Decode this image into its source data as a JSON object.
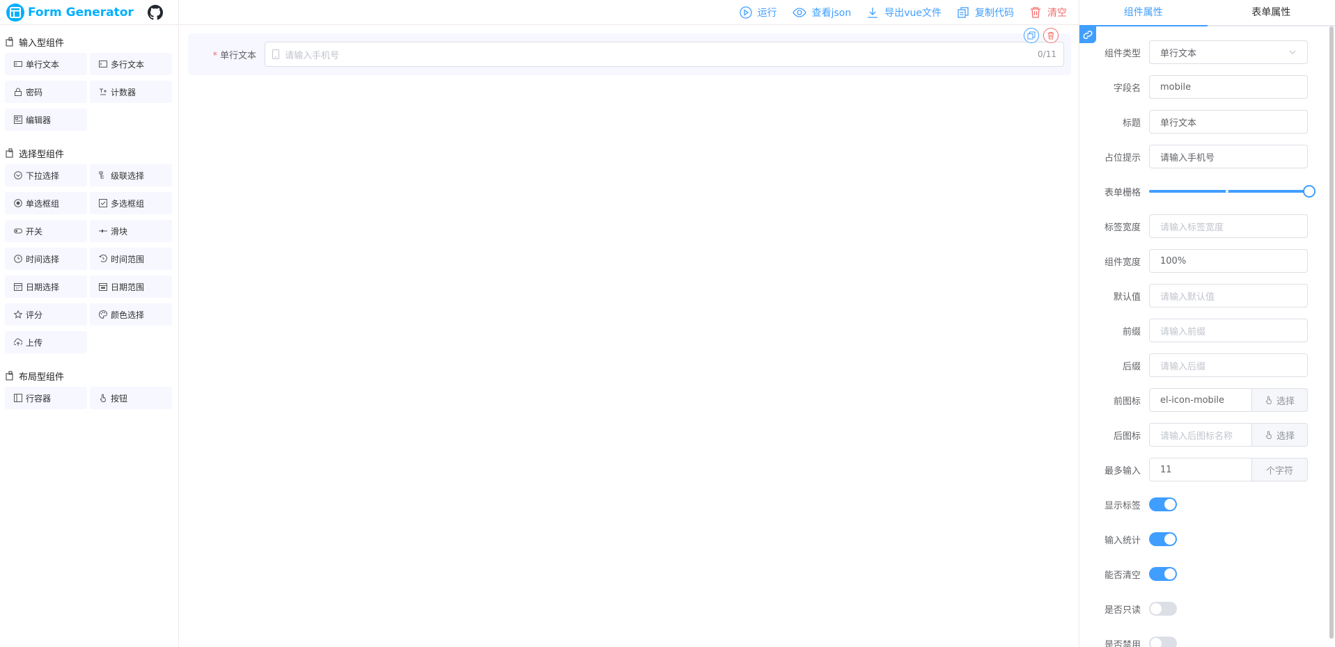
{
  "app": {
    "title": "Form Generator"
  },
  "groups": [
    {
      "title": "输入型组件",
      "items": [
        {
          "label": "单行文本",
          "icon": "input-icon"
        },
        {
          "label": "多行文本",
          "icon": "textarea-icon"
        },
        {
          "label": "密码",
          "icon": "password-icon"
        },
        {
          "label": "计数器",
          "icon": "number-icon"
        },
        {
          "label": "编辑器",
          "icon": "editor-icon"
        }
      ]
    },
    {
      "title": "选择型组件",
      "items": [
        {
          "label": "下拉选择",
          "icon": "select-icon"
        },
        {
          "label": "级联选择",
          "icon": "cascader-icon"
        },
        {
          "label": "单选框组",
          "icon": "radio-icon"
        },
        {
          "label": "多选框组",
          "icon": "checkbox-icon"
        },
        {
          "label": "开关",
          "icon": "switch-icon"
        },
        {
          "label": "滑块",
          "icon": "slider-icon"
        },
        {
          "label": "时间选择",
          "icon": "time-icon"
        },
        {
          "label": "时间范围",
          "icon": "time-range-icon"
        },
        {
          "label": "日期选择",
          "icon": "date-icon"
        },
        {
          "label": "日期范围",
          "icon": "date-range-icon"
        },
        {
          "label": "评分",
          "icon": "rate-icon"
        },
        {
          "label": "颜色选择",
          "icon": "color-icon"
        },
        {
          "label": "上传",
          "icon": "upload-icon"
        }
      ]
    },
    {
      "title": "布局型组件",
      "items": [
        {
          "label": "行容器",
          "icon": "row-icon"
        },
        {
          "label": "按钮",
          "icon": "button-icon"
        }
      ]
    }
  ],
  "toolbar": {
    "run": "运行",
    "view_json": "查看json",
    "export_vue": "导出vue文件",
    "copy_code": "复制代码",
    "clear": "清空"
  },
  "canvas": {
    "field_label": "单行文本",
    "placeholder": "请输入手机号",
    "counter": "0/11"
  },
  "right": {
    "tab_component": "组件属性",
    "tab_form": "表单属性",
    "fields": {
      "type": {
        "label": "组件类型",
        "value": "单行文本"
      },
      "field_name": {
        "label": "字段名",
        "value": "mobile"
      },
      "title": {
        "label": "标题",
        "value": "单行文本"
      },
      "placeholder": {
        "label": "占位提示",
        "value": "请输入手机号"
      },
      "span": {
        "label": "表单栅格",
        "value": 24,
        "max": 24
      },
      "label_width": {
        "label": "标签宽度",
        "placeholder": "请输入标签宽度"
      },
      "width": {
        "label": "组件宽度",
        "value": "100%"
      },
      "default": {
        "label": "默认值",
        "placeholder": "请输入默认值"
      },
      "prefix": {
        "label": "前缀",
        "placeholder": "请输入前缀"
      },
      "suffix": {
        "label": "后缀",
        "placeholder": "请输入后缀"
      },
      "prefix_icon": {
        "label": "前图标",
        "value": "el-icon-mobile",
        "button": "选择"
      },
      "suffix_icon": {
        "label": "后图标",
        "placeholder": "请输入后图标名称",
        "button": "选择"
      },
      "maxlength": {
        "label": "最多输入",
        "value": "11",
        "append": "个字符"
      },
      "show_label": {
        "label": "显示标签",
        "on": true
      },
      "show_word_limit": {
        "label": "输入统计",
        "on": true
      },
      "clearable": {
        "label": "能否清空",
        "on": true
      },
      "readonly": {
        "label": "是否只读",
        "on": false
      },
      "disabled": {
        "label": "是否禁用",
        "on": false
      }
    }
  },
  "colors": {
    "primary": "#409eff",
    "danger": "#f56c6c",
    "logo": "#00afff"
  }
}
